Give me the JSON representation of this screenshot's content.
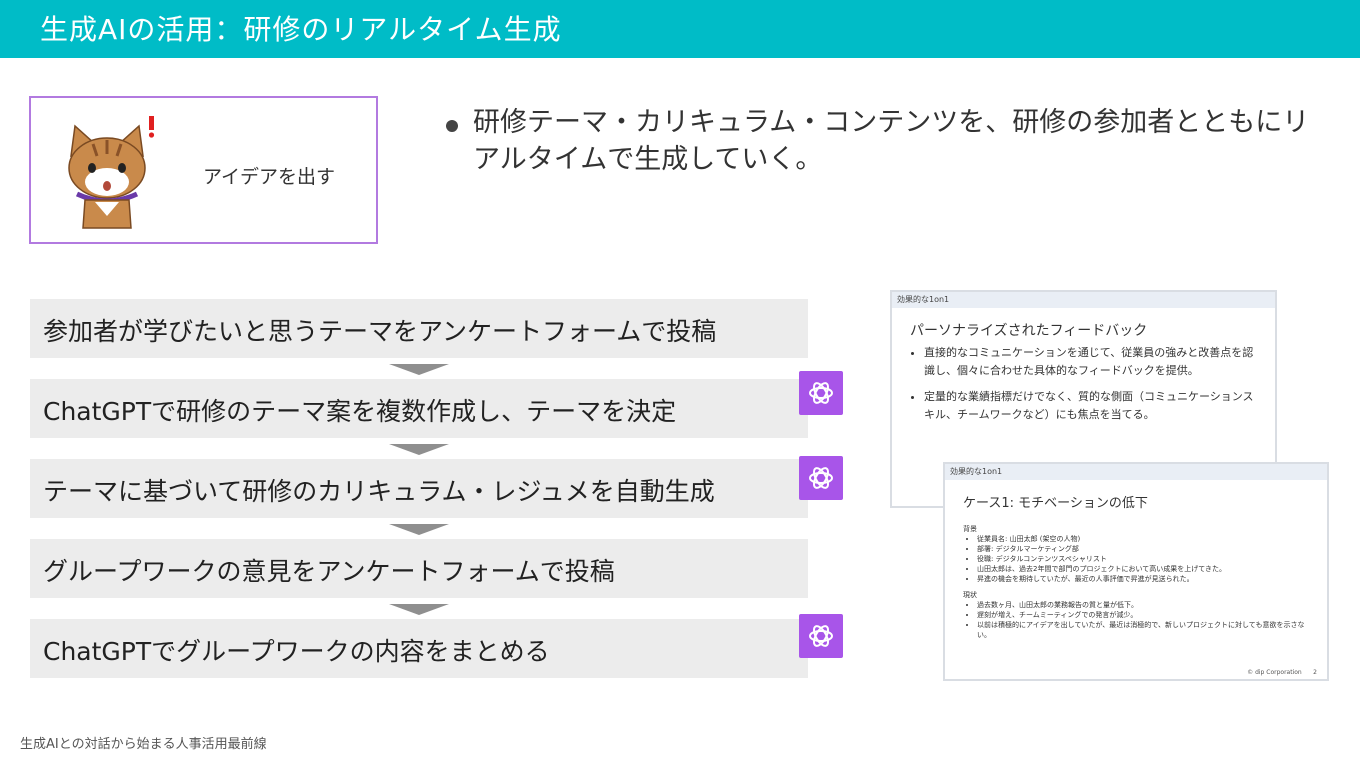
{
  "slide": {
    "title": "生成AIの活用：研修のリアルタイム生成",
    "idea_label": "アイデアを出す",
    "bullet": "研修テーマ・カリキュラム・コンテンツを、研修の参加者とともにリアルタイムで生成していく。",
    "steps": [
      "参加者が学びたいと思うテーマをアンケートフォームで投稿",
      "ChatGPTで研修のテーマ案を複数作成し、テーマを決定",
      "テーマに基づいて研修のカリキュラム・レジュメを自動生成",
      "グループワークの意見をアンケートフォームで投稿",
      "ChatGPTでグループワークの内容をまとめる"
    ],
    "footer": "生成AIとの対話から始まる人事活用最前線"
  },
  "card1": {
    "header": "効果的な1on1",
    "title": "パーソナライズされたフィードバック",
    "bullets": [
      "直接的なコミュニケーションを通じて、従業員の強みと改善点を認識し、個々に合わせた具体的なフィードバックを提供。",
      "定量的な業績指標だけでなく、質的な側面（コミュニケーションスキル、チームワークなど）にも焦点を当てる。"
    ]
  },
  "card2": {
    "header": "効果的な1on1",
    "title": "ケース1: モチベーションの低下",
    "section1": "背景",
    "bullets1": [
      "従業員名: 山田太郎 (架空の人物)",
      "部署: デジタルマーケティング部",
      "役職: デジタルコンテンツスペシャリスト",
      "山田太郎は、過去2年間で部門のプロジェクトにおいて高い成果を上げてきた。",
      "昇進の機会を期待していたが、最近の人事評価で昇進が見送られた。"
    ],
    "section2": "現状",
    "bullets2": [
      "過去数ヶ月、山田太郎の業務報告の質と量が低下。",
      "遅刻が増え、チームミーティングでの発言が減少。",
      "以前は積極的にアイデアを出していたが、最近は消極的で、新しいプロジェクトに対しても意欲を示さない。"
    ],
    "footer_company": "© dip Corporation",
    "page": "2"
  },
  "icons": {
    "gpt_color": "#a855e9",
    "accent": "#00bcc7",
    "gpt_icon": "chatgpt-logo-icon",
    "bullet_icon": "bullet-dot-icon"
  }
}
